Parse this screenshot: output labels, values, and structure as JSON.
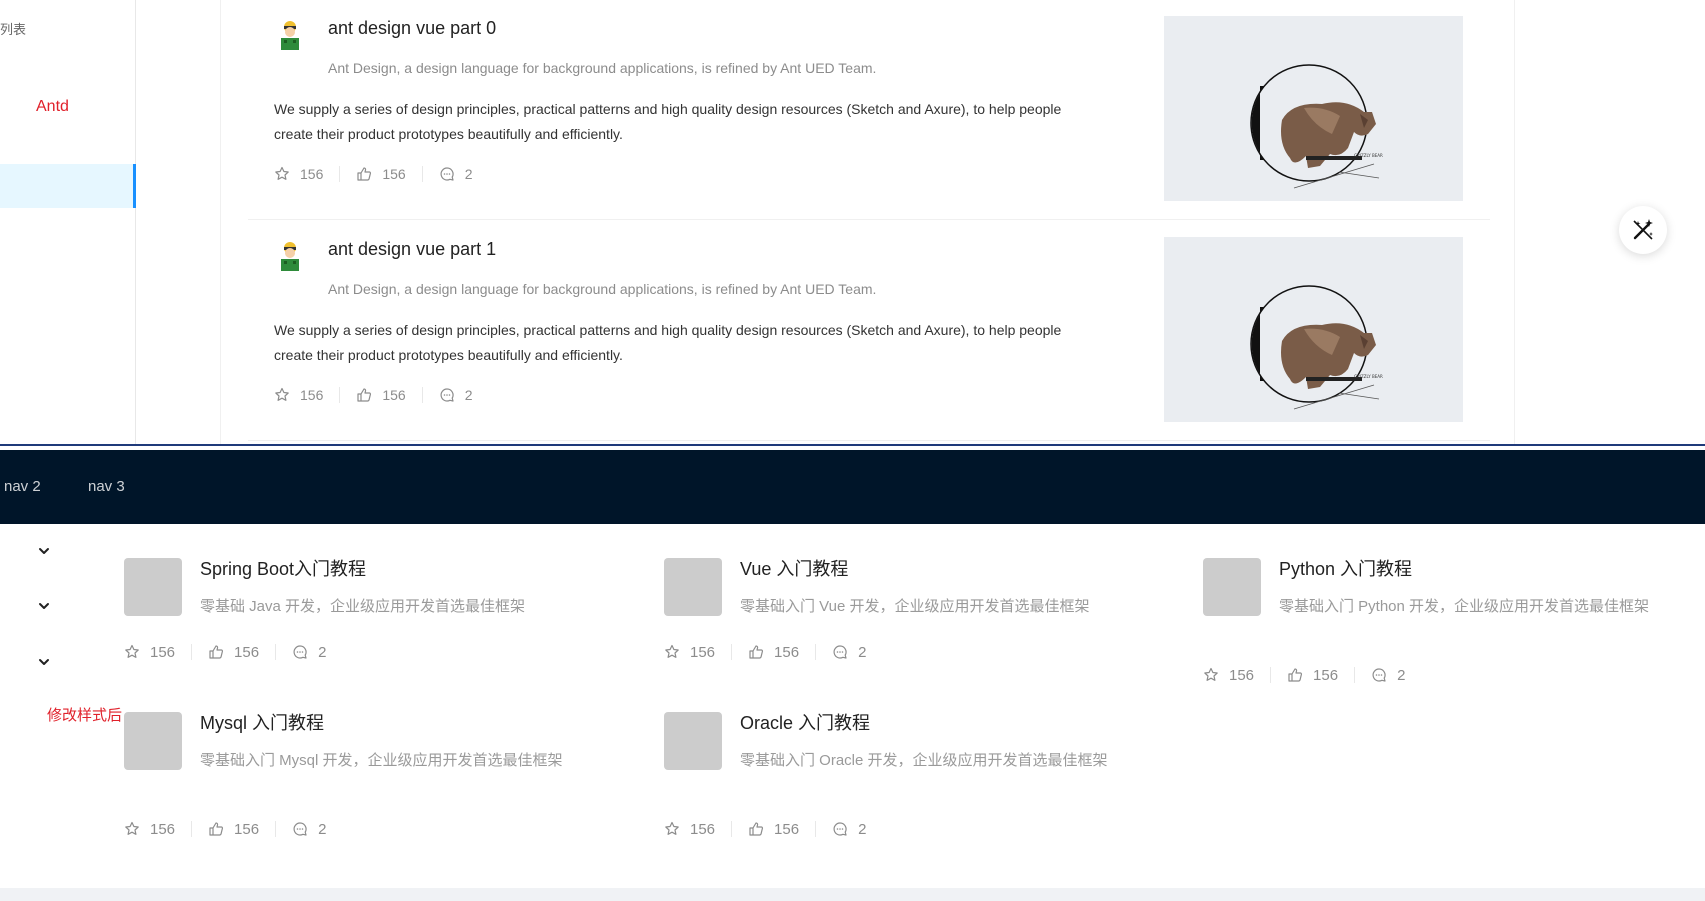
{
  "top_panel": {
    "sidebar": {
      "title": "列表",
      "active_item": "Antd"
    },
    "articles": [
      {
        "title": "ant design vue part 0",
        "description": "Ant Design, a design language for background applications, is refined by Ant UED Team.",
        "content": "We supply a series of design principles, practical patterns and high quality design resources (Sketch and Axure), to help people create their product prototypes beautifully and efficiently.",
        "stars": "156",
        "likes": "156",
        "comments": "2",
        "image_caption": "GRIZZLY BEAR"
      },
      {
        "title": "ant design vue part 1",
        "description": "Ant Design, a design language for background applications, is refined by Ant UED Team.",
        "content": "We supply a series of design principles, practical patterns and high quality design resources (Sketch and Axure), to help people create their product prototypes beautifully and efficiently.",
        "stars": "156",
        "likes": "156",
        "comments": "2",
        "image_caption": "GRIZZLY BEAR"
      }
    ],
    "floating_button_icon": "magic-wand-icon"
  },
  "bottom_panel": {
    "nav": [
      "nav 2",
      "nav 3"
    ],
    "note": "修改样式后",
    "cards": [
      {
        "title": "Spring Boot入门教程",
        "description": "零基础 Java 开发，企业级应用开发首选最佳框架",
        "stars": "156",
        "likes": "156",
        "comments": "2"
      },
      {
        "title": "Vue 入门教程",
        "description": "零基础入门 Vue 开发，企业级应用开发首选最佳框架",
        "stars": "156",
        "likes": "156",
        "comments": "2"
      },
      {
        "title": "Python 入门教程",
        "description": "零基础入门 Python 开发，企业级应用开发首选最佳框架",
        "stars": "156",
        "likes": "156",
        "comments": "2"
      },
      {
        "title": "Mysql 入门教程",
        "description": "零基础入门 Mysql 开发，企业级应用开发首选最佳框架",
        "stars": "156",
        "likes": "156",
        "comments": "2"
      },
      {
        "title": "Oracle 入门教程",
        "description": "零基础入门 Oracle 开发，企业级应用开发首选最佳框架",
        "stars": "156",
        "likes": "156",
        "comments": "2"
      }
    ]
  },
  "colors": {
    "nav_background": "#001529",
    "accent_red": "#e0202a",
    "selected_bg": "#e6f7ff",
    "selected_border": "#1890ff",
    "thumb_gray": "#cccccc"
  }
}
